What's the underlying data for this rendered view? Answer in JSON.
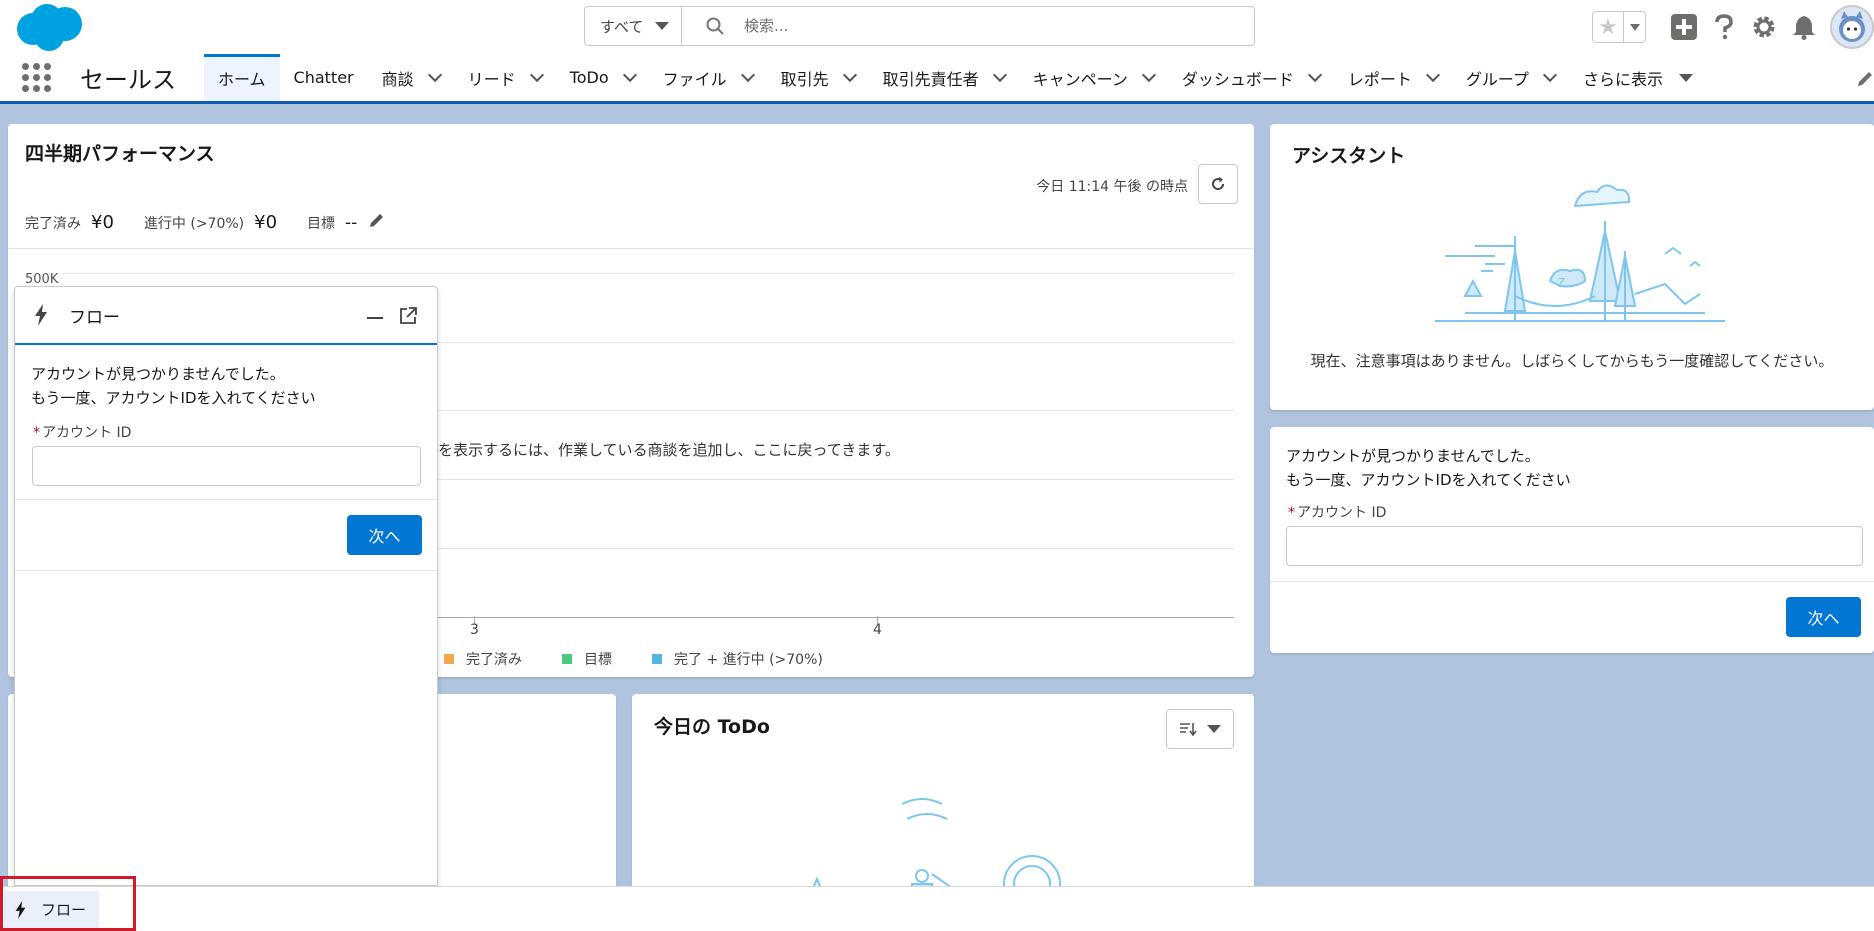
{
  "header": {
    "search_scope": "すべて",
    "search_placeholder": "検索..."
  },
  "nav": {
    "app_name": "セールス",
    "items": [
      {
        "label": "ホーム"
      },
      {
        "label": "Chatter"
      },
      {
        "label": "商談"
      },
      {
        "label": "リード"
      },
      {
        "label": "ToDo"
      },
      {
        "label": "ファイル"
      },
      {
        "label": "取引先"
      },
      {
        "label": "取引先責任者"
      },
      {
        "label": "キャンペーン"
      },
      {
        "label": "ダッシュボード"
      },
      {
        "label": "レポート"
      },
      {
        "label": "グループ"
      },
      {
        "label": "さらに表示"
      }
    ]
  },
  "performance": {
    "title": "四半期パフォーマンス",
    "as_of": "今日 11:14 午後 の時点",
    "completed_label": "完了済み",
    "completed_value": "¥0",
    "in_progress_label": "進行中 (>70%)",
    "in_progress_value": "¥0",
    "goal_label": "目標",
    "goal_value": "--",
    "y_top_tick": "500K",
    "empty_message": "を表示するには、作業している商談を追加し、ここに戻ってきます。",
    "x_ticks": [
      "3",
      "4"
    ],
    "legend": [
      {
        "label": "完了済み",
        "color": "#f2a94b"
      },
      {
        "label": "目標",
        "color": "#4bca81"
      },
      {
        "label": "完了 + 進行中 (>70%)",
        "color": "#54b7e0"
      }
    ]
  },
  "assistant": {
    "title": "アシスタント",
    "message": "現在、注意事項はありません。しばらくしてからもう一度確認してください。"
  },
  "flow_card": {
    "line1": "アカウントが見つかりませんでした。",
    "line2": "もう一度、アカウントIDを入れてください",
    "field_label": "アカウント ID",
    "required_mark": "*",
    "next": "次へ"
  },
  "flow_panel": {
    "title": "フロー",
    "line1": "アカウントが見つかりませんでした。",
    "line2": "もう一度、アカウントIDを入れてください",
    "field_label": "アカウント ID",
    "required_mark": "*",
    "next": "次へ"
  },
  "todo": {
    "title": "今日の ToDo"
  },
  "utility_bar": {
    "flow_label": "フロー"
  }
}
